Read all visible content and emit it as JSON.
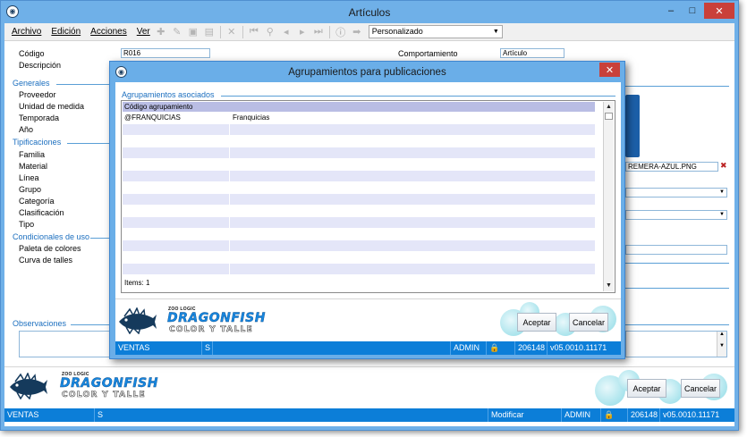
{
  "window": {
    "title": "Artículos",
    "controls": {
      "minimize": "–",
      "maximize": "□",
      "close": "✕"
    }
  },
  "menu": [
    "Archivo",
    "Edición",
    "Acciones",
    "Ver"
  ],
  "toolbar": {
    "icons": [
      "new-icon",
      "edit-icon",
      "save-icon",
      "save-as-icon",
      "delete-icon",
      "first-icon",
      "search-icon",
      "prev-icon",
      "next-icon",
      "last-icon",
      "info-icon",
      "forward-icon"
    ],
    "view_select": "Personalizado"
  },
  "form": {
    "codigo_label": "Código",
    "codigo_value": "R016",
    "descripcion_label": "Descripción",
    "comportamiento_label": "Comportamiento",
    "comportamiento_value": "Artículo",
    "image_file": "REMERA-AZUL.PNG"
  },
  "sections": {
    "generales": {
      "title": "Generales",
      "items": [
        "Proveedor",
        "Unidad de medida",
        "Temporada",
        "Año"
      ]
    },
    "tipificaciones": {
      "title": "Tipificaciones",
      "items": [
        "Familia",
        "Material",
        "Línea",
        "Grupo",
        "Categoría",
        "Clasificación",
        "Tipo"
      ]
    },
    "condiciones": {
      "title": "Condicionales de uso",
      "items": [
        "Paleta de colores",
        "Curva de talles"
      ]
    },
    "observaciones": {
      "title": "Observaciones"
    }
  },
  "buttons": {
    "aceptar": "Aceptar",
    "cancelar": "Cancelar"
  },
  "logo": {
    "brand": "ZOO LOGIC",
    "product": "DRAGONFISH",
    "edition": "COLOR Y TALLE"
  },
  "status": {
    "db": "VENTAS",
    "s": "S",
    "mode": "Modificar",
    "user": "ADMIN",
    "code": "206148",
    "version": "v05.0010.11171"
  },
  "dialog": {
    "title": "Agrupamientos para publicaciones",
    "section": "Agrupamientos asociados",
    "column": "Código agrupamiento",
    "rows": [
      {
        "code": "@FRANQUICIAS",
        "desc": "Franquicias"
      }
    ],
    "items_count": "Items: 1",
    "buttons": {
      "aceptar": "Aceptar",
      "cancelar": "Cancelar"
    },
    "status": {
      "db": "VENTAS",
      "s": "S",
      "user": "ADMIN",
      "code": "206148",
      "version": "v05.0010.11171"
    }
  },
  "colors": {
    "accent": "#0c7ed8",
    "titlebar": "#6fb0e8",
    "section": "#1c6fbf",
    "grid_header": "#b9bde4",
    "grid_row_alt": "#e4e6f8"
  }
}
